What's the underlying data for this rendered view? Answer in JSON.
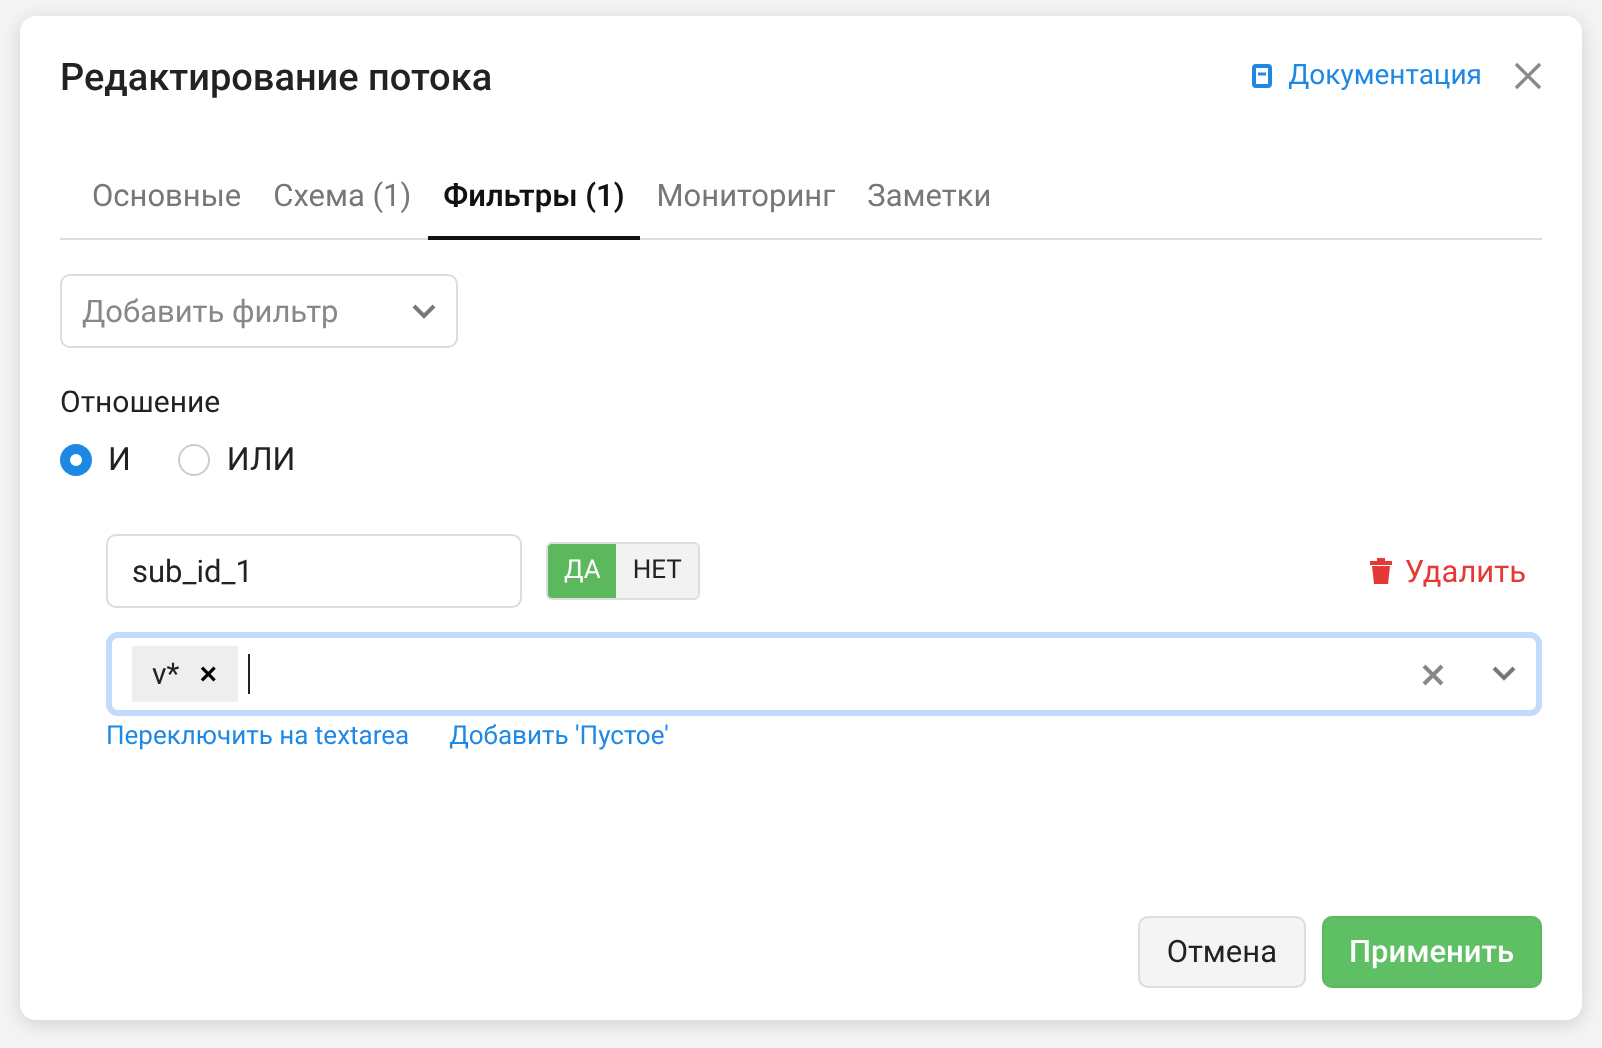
{
  "dialog": {
    "title": "Редактирование потока",
    "doc_link": "Документация"
  },
  "tabs": [
    {
      "label": "Основные",
      "selected": false
    },
    {
      "label": "Схема (1)",
      "selected": false
    },
    {
      "label": "Фильтры (1)",
      "selected": true
    },
    {
      "label": "Мониторинг",
      "selected": false
    },
    {
      "label": "Заметки",
      "selected": false
    }
  ],
  "add_filter": {
    "placeholder": "Добавить фильтр"
  },
  "relation": {
    "label": "Отношение",
    "options": [
      {
        "label": "И",
        "selected": true
      },
      {
        "label": "ИЛИ",
        "selected": false
      }
    ]
  },
  "filter": {
    "field": "sub_id_1",
    "toggle": [
      {
        "label": "ДА",
        "selected": true
      },
      {
        "label": "НЕТ",
        "selected": false
      }
    ],
    "delete": "Удалить",
    "tags": [
      {
        "label": "v*",
        "remove": "×"
      }
    ],
    "focused": true,
    "links": [
      "Переключить на textarea",
      "Добавить 'Пустое'"
    ]
  },
  "buttons": [
    {
      "label": "Отмена",
      "kind": "secondary"
    },
    {
      "label": "Применить",
      "kind": "primary"
    }
  ]
}
